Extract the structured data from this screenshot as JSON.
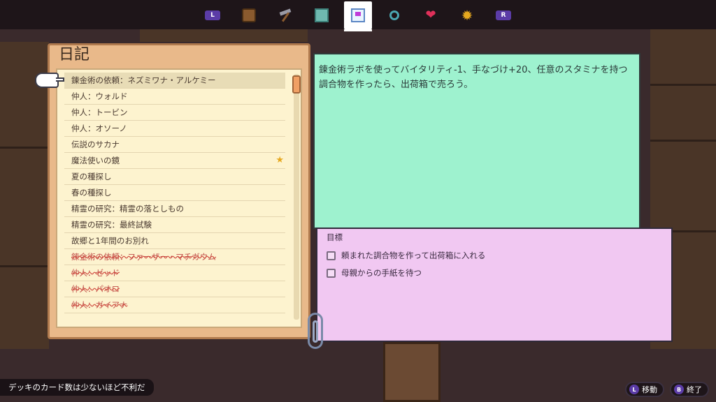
{
  "nav": {
    "l_key": "L",
    "r_key": "R",
    "icons": [
      "backpack-icon",
      "pickaxe-icon",
      "map-icon",
      "diary-icon",
      "magnifier-icon",
      "heart-icon",
      "gear-icon"
    ],
    "active": "diary-icon"
  },
  "diary": {
    "title": "日記",
    "entries": [
      {
        "label": "錬金術の依頼：ネズミワナ・アルケミー",
        "selected": true,
        "done": false
      },
      {
        "label": "仲人：ウォルド",
        "done": false
      },
      {
        "label": "仲人：トービン",
        "done": false
      },
      {
        "label": "仲人：オソーノ",
        "done": false
      },
      {
        "label": "伝説のサカナ",
        "done": false
      },
      {
        "label": "魔法使いの鏡",
        "done": false,
        "starred": true
      },
      {
        "label": "夏の種探し",
        "done": false
      },
      {
        "label": "春の種探し",
        "done": false
      },
      {
        "label": "精霊の研究：精霊の落としもの",
        "done": false
      },
      {
        "label": "精霊の研究：最終試験",
        "done": false
      },
      {
        "label": "故郷と1年間のお別れ",
        "done": false
      },
      {
        "label": "錬金術の依頼：ファーザー・マチガウム",
        "done": true
      },
      {
        "label": "仲人：ゼッド",
        "done": true
      },
      {
        "label": "仲人：パオロ",
        "done": true
      },
      {
        "label": "仲人：ガイアナ",
        "done": true
      }
    ]
  },
  "description": "錬金術ラボを使ってバイタリティ-1、手なづけ+20、任意のスタミナを持つ調合物を作ったら、出荷箱で売ろう。",
  "objectives": {
    "title": "目標",
    "items": [
      {
        "label": "頼まれた調合物を作って出荷箱に入れる",
        "checked": false
      },
      {
        "label": "母親からの手紙を待つ",
        "checked": false
      }
    ]
  },
  "footer": {
    "tip": "デッキのカード数は少ないほど不利だ",
    "move_key": "L",
    "move_label": "移動",
    "exit_key": "B",
    "exit_label": "終了"
  },
  "colors": {
    "description_bg": "#9ef2cf",
    "objectives_bg": "#f1c8f2",
    "page_bg": "#fdf3cf",
    "book_cover": "#e9b98a",
    "button_purple": "#5b3ca7"
  }
}
